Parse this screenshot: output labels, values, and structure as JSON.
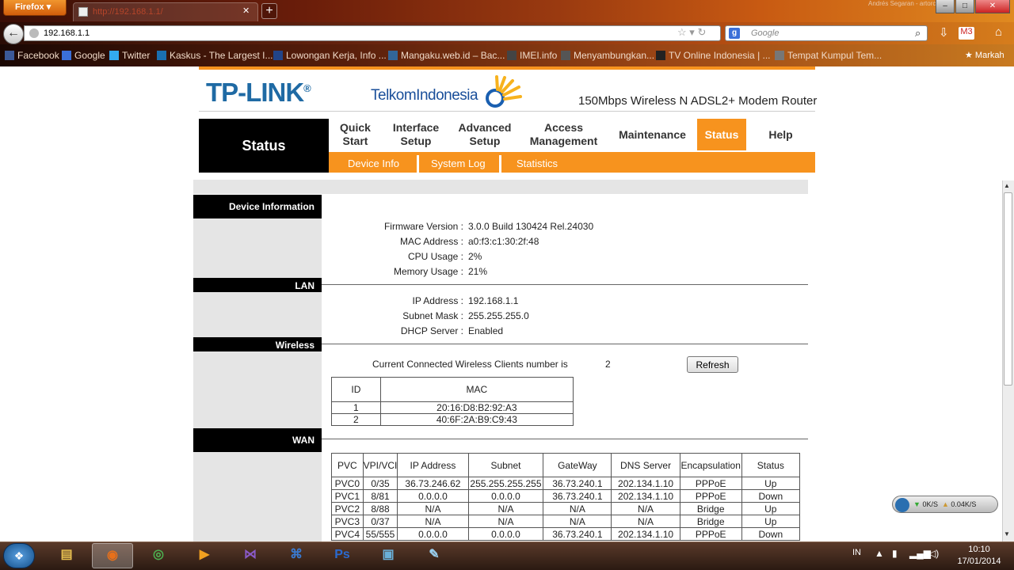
{
  "browser": {
    "app_button": "Firefox",
    "tab_title": "http://192.168.1.1/",
    "url": "192.168.1.1",
    "search_placeholder": "Google",
    "watermark": "Andrés Segaran - artorc",
    "bookmarks": [
      {
        "label": "Facebook",
        "icon": "facebook-icon",
        "color": "#3b5998"
      },
      {
        "label": "Google",
        "icon": "google-icon",
        "color": "#3b6fd8"
      },
      {
        "label": "Twitter",
        "icon": "twitter-icon",
        "color": "#33aaf0"
      },
      {
        "label": "Kaskus - The Largest I...",
        "icon": "kaskus-icon",
        "color": "#1a6fb0"
      },
      {
        "label": "Lowongan Kerja, Info ...",
        "icon": "page-icon",
        "color": "#224488"
      },
      {
        "label": "Mangaku.web.id – Bac...",
        "icon": "mangaku-icon",
        "color": "#336699"
      },
      {
        "label": "IMEI.info",
        "icon": "imei-icon",
        "color": "#444"
      },
      {
        "label": "Menyambungkan...",
        "icon": "page-icon",
        "color": "#555"
      },
      {
        "label": "TV Online Indonesia | ...",
        "icon": "tv-icon",
        "color": "#222"
      },
      {
        "label": "Tempat Kumpul Tem...",
        "icon": "page-icon",
        "color": "#777"
      }
    ],
    "bookmarks_menu": "Markah",
    "mail_badge": "3"
  },
  "router": {
    "brand": "TP-LINK",
    "partner": "TelkomIndonesia",
    "model": "150Mbps Wireless N ADSL2+ Modem Router",
    "section_title": "Status",
    "menu": [
      {
        "label": "Quick\nStart",
        "active": false
      },
      {
        "label": "Interface\nSetup",
        "active": false
      },
      {
        "label": "Advanced\nSetup",
        "active": false
      },
      {
        "label": "Access\nManagement",
        "active": false
      },
      {
        "label": "Maintenance",
        "active": false
      },
      {
        "label": "Status",
        "active": true
      },
      {
        "label": "Help",
        "active": false
      }
    ],
    "submenu": [
      "Device Info",
      "System Log",
      "Statistics"
    ],
    "accent": "#f7931e",
    "sections": {
      "device": "Device Information",
      "lan": "LAN",
      "wireless": "Wireless",
      "wan": "WAN"
    },
    "device_info": [
      {
        "key": "Firmware Version",
        "value": "3.0.0 Build 130424 Rel.24030"
      },
      {
        "key": "MAC Address",
        "value": "a0:f3:c1:30:2f:48"
      },
      {
        "key": "CPU Usage",
        "value": "2%"
      },
      {
        "key": "Memory Usage",
        "value": "21%"
      }
    ],
    "lan_info": [
      {
        "key": "IP Address",
        "value": "192.168.1.1"
      },
      {
        "key": "Subnet Mask",
        "value": "255.255.255.0"
      },
      {
        "key": "DHCP Server",
        "value": "Enabled"
      }
    ],
    "wireless": {
      "clients_text": "Current Connected Wireless Clients number is",
      "clients_count": "2",
      "refresh": "Refresh",
      "headers": [
        "ID",
        "MAC"
      ],
      "rows": [
        [
          "1",
          "20:16:D8:B2:92:A3"
        ],
        [
          "2",
          "40:6F:2A:B9:C9:43"
        ]
      ]
    },
    "wan": {
      "headers": [
        "PVC",
        "VPI/VCI",
        "IP Address",
        "Subnet",
        "GateWay",
        "DNS Server",
        "Encapsulation",
        "Status"
      ],
      "rows": [
        [
          "PVC0",
          "0/35",
          "36.73.246.62",
          "255.255.255.255",
          "36.73.240.1",
          "202.134.1.10",
          "PPPoE",
          "Up"
        ],
        [
          "PVC1",
          "8/81",
          "0.0.0.0",
          "0.0.0.0",
          "36.73.240.1",
          "202.134.1.10",
          "PPPoE",
          "Down"
        ],
        [
          "PVC2",
          "8/88",
          "N/A",
          "N/A",
          "N/A",
          "N/A",
          "Bridge",
          "Up"
        ],
        [
          "PVC3",
          "0/37",
          "N/A",
          "N/A",
          "N/A",
          "N/A",
          "Bridge",
          "Up"
        ],
        [
          "PVC4",
          "55/555",
          "0.0.0.0",
          "0.0.0.0",
          "36.73.240.1",
          "202.134.1.10",
          "PPPoE",
          "Down"
        ]
      ]
    }
  },
  "net_widget": {
    "down": "0K/S",
    "up": "0.04K/S"
  },
  "taskbar": {
    "apps": [
      "explorer-icon",
      "firefox-icon",
      "chrome-icon",
      "media-player-icon",
      "visual-studio-icon",
      "network-icon",
      "photoshop-icon",
      "window-icon",
      "paint-icon"
    ],
    "lang": "IN",
    "time": "10:10",
    "date": "17/01/2014"
  }
}
